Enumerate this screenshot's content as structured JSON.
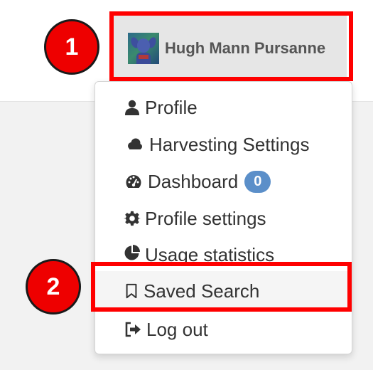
{
  "user": {
    "name": "Hugh Mann Pursanne"
  },
  "menu": {
    "profile": "Profile",
    "harvesting_settings": "Harvesting Settings",
    "dashboard": "Dashboard",
    "dashboard_badge": "0",
    "profile_settings": "Profile settings",
    "usage_statistics": "Usage statistics",
    "saved_search": "Saved Search",
    "log_out": "Log out"
  },
  "annotations": {
    "first": "1",
    "second": "2"
  },
  "colors": {
    "highlight": "#ff0000",
    "badge": "#5b8fc9",
    "marker": "#ee0000",
    "hovered_item": "#f5f5f5"
  },
  "icons": [
    "user-icon",
    "cloud-icon",
    "dashboard-icon",
    "gear-icon",
    "pie-chart-icon",
    "bookmark-icon",
    "sign-out-icon"
  ]
}
